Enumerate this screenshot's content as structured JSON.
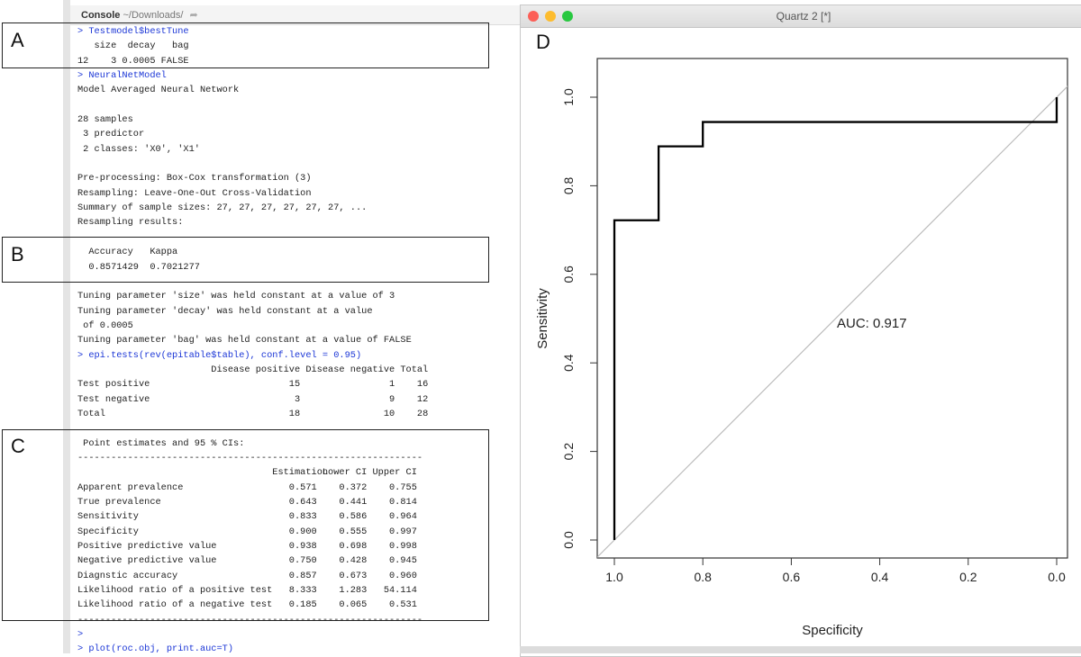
{
  "console": {
    "title": "Console",
    "path": "~/Downloads/",
    "arrow_icon": "forward-arrow-icon",
    "lines_a": [
      {
        "text": "> Testmodel$bestTune",
        "type": "cmd"
      },
      {
        "text": "   size  decay   bag",
        "type": "out"
      },
      {
        "text": "12    3 0.0005 FALSE",
        "type": "out"
      },
      {
        "text": "> NeuralNetModel",
        "type": "cmd"
      },
      {
        "text": "Model Averaged Neural Network",
        "type": "out"
      },
      {
        "text": "",
        "type": "out"
      },
      {
        "text": "28 samples",
        "type": "out"
      },
      {
        "text": " 3 predictor",
        "type": "out"
      },
      {
        "text": " 2 classes: 'X0', 'X1'",
        "type": "out"
      },
      {
        "text": "",
        "type": "out"
      },
      {
        "text": "Pre-processing: Box-Cox transformation (3)",
        "type": "out"
      },
      {
        "text": "Resampling: Leave-One-Out Cross-Validation",
        "type": "out"
      },
      {
        "text": "Summary of sample sizes: 27, 27, 27, 27, 27, 27, ...",
        "type": "out"
      },
      {
        "text": "Resampling results:",
        "type": "out"
      },
      {
        "text": "",
        "type": "out"
      },
      {
        "text": "  Accuracy   Kappa",
        "type": "out"
      },
      {
        "text": "  0.8571429  0.7021277",
        "type": "out"
      },
      {
        "text": "",
        "type": "out"
      },
      {
        "text": "Tuning parameter 'size' was held constant at a value of 3",
        "type": "out"
      },
      {
        "text": "Tuning parameter 'decay' was held constant at a value",
        "type": "out"
      },
      {
        "text": " of 0.0005",
        "type": "out"
      },
      {
        "text": "Tuning parameter 'bag' was held constant at a value of FALSE",
        "type": "out"
      },
      {
        "text": "> epi.tests(rev(epitable$table), conf.level = 0.95)",
        "type": "cmd"
      }
    ],
    "epi_table": {
      "headers": [
        "",
        "Disease positive",
        "Disease negative",
        "Total"
      ],
      "rows": [
        [
          "Test positive",
          "15",
          "1",
          "16"
        ],
        [
          "Test negative",
          "3",
          "9",
          "12"
        ],
        [
          "Total",
          "18",
          "10",
          "28"
        ]
      ]
    },
    "ci_title": " Point estimates and 95 % CIs:",
    "divider": "--------------------------------------------------------------",
    "ci_table": {
      "headers": [
        "",
        "Estimation",
        "Lower CI",
        "Upper CI"
      ],
      "rows": [
        [
          "Apparent prevalence",
          "0.571",
          "0.372",
          "0.755"
        ],
        [
          "True prevalence",
          "0.643",
          "0.441",
          "0.814"
        ],
        [
          "Sensitivity",
          "0.833",
          "0.586",
          "0.964"
        ],
        [
          "Specificity",
          "0.900",
          "0.555",
          "0.997"
        ],
        [
          "Positive predictive value",
          "0.938",
          "0.698",
          "0.998"
        ],
        [
          "Negative predictive value",
          "0.750",
          "0.428",
          "0.945"
        ],
        [
          "Diagnstic accuracy",
          "0.857",
          "0.673",
          "0.960"
        ],
        [
          "Likelihood ratio of a positive test",
          "8.333",
          "1.283",
          "54.114"
        ],
        [
          "Likelihood ratio of a negative test",
          "0.185",
          "0.065",
          "0.531"
        ]
      ]
    },
    "lines_end": [
      {
        "text": ">",
        "type": "cmd"
      },
      {
        "text": "> plot(roc.obj, print.auc=T)",
        "type": "cmd"
      }
    ]
  },
  "panel_labels": {
    "a": "A",
    "b": "B",
    "c": "C",
    "d": "D"
  },
  "quartz": {
    "title": "Quartz 2 [*]",
    "colors": {
      "close": "#fc5f57",
      "minimize": "#fdbc2e",
      "zoom": "#28c840"
    }
  },
  "chart_data": {
    "type": "line",
    "title": "",
    "xlabel": "Specificity",
    "ylabel": "Sensitivity",
    "xlim": [
      1.0,
      0.0
    ],
    "ylim": [
      0.0,
      1.0
    ],
    "xticks": [
      "1.0",
      "0.8",
      "0.6",
      "0.4",
      "0.2",
      "0.0"
    ],
    "yticks": [
      "0.0",
      "0.2",
      "0.4",
      "0.6",
      "0.8",
      "1.0"
    ],
    "series": [
      {
        "name": "ROC",
        "color": "#000000",
        "x": [
          1.0,
          1.0,
          0.9,
          0.9,
          0.8,
          0.8,
          0.0,
          0.0
        ],
        "y": [
          0.0,
          0.722,
          0.722,
          0.889,
          0.889,
          0.944,
          0.944,
          1.0
        ]
      },
      {
        "name": "reference diagonal",
        "color": "#bbbbbb",
        "x": [
          1.0,
          0.0
        ],
        "y": [
          0.0,
          1.0
        ]
      }
    ],
    "annotation": "AUC: 0.917",
    "grid": false
  }
}
